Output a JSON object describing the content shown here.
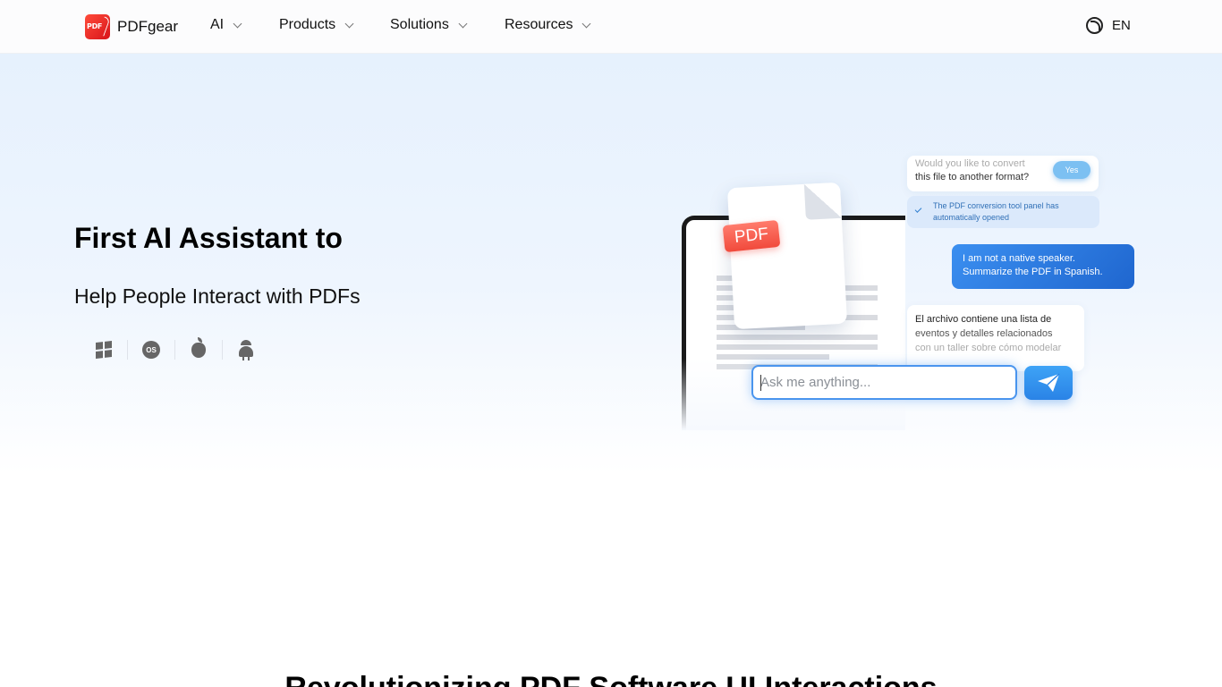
{
  "header": {
    "logo_mark": "PDF",
    "logo_text": "PDFgear",
    "nav": [
      {
        "label": "AI"
      },
      {
        "label": "Products"
      },
      {
        "label": "Solutions"
      },
      {
        "label": "Resources"
      }
    ],
    "language": "EN",
    "language_icon": "globe-icon"
  },
  "hero": {
    "title": "First AI Assistant to",
    "subtitle": "Help People Interact with PDFs",
    "platforms": [
      "windows-icon",
      "macos-icon",
      "apple-icon",
      "android-icon"
    ],
    "macos_label": "OS"
  },
  "illustration": {
    "pdf_tag": "PDF",
    "bubble_question_line1": "Would you like to convert",
    "bubble_question_line2": "this file to another format?",
    "yes_label": "Yes",
    "status_line1": "The PDF conversion tool panel has",
    "status_line2": "automatically opened",
    "user_line1": "I am not a native speaker.",
    "user_line2": "Summarize the PDF in Spanish.",
    "reply_line1": "El archivo contiene una lista de",
    "reply_line2": "eventos y detalles relacionados",
    "reply_line3": "con un taller sobre cómo modelar",
    "ask_placeholder": "Ask me anything...",
    "send_icon": "paper-plane-icon"
  },
  "section": {
    "title": "Revolutionizing PDF Software UI Interactions"
  },
  "colors": {
    "accent": "#2a83e6",
    "brand_red": "#e8261e",
    "hero_bg": "#e6f1fd"
  }
}
